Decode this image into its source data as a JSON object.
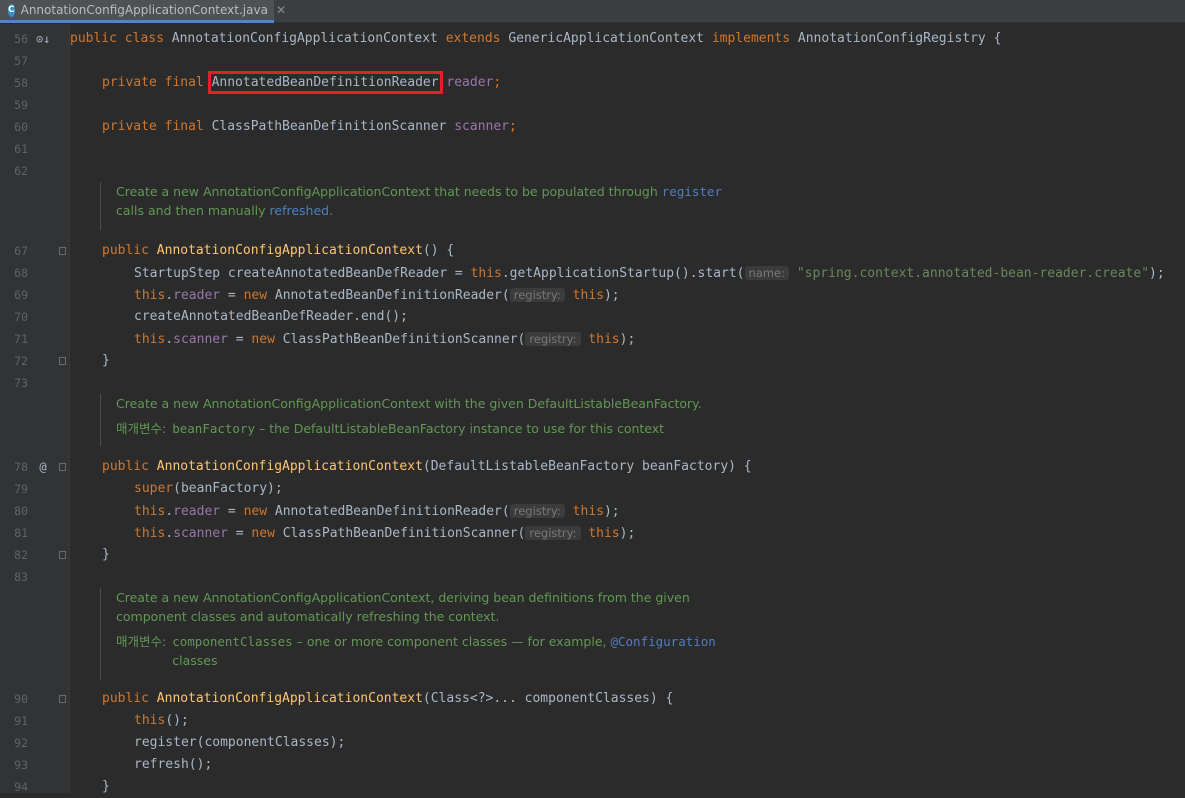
{
  "tab": {
    "icon": "C",
    "filename": "AnnotationConfigApplicationContext.java",
    "close": "✕"
  },
  "lines": [
    {
      "n": "56",
      "mark": "⊙↓",
      "code": [
        [
          "public class ",
          "kw"
        ],
        [
          "AnnotationConfigApplicationContext ",
          ""
        ],
        [
          "extends ",
          "kw"
        ],
        [
          "GenericApplicationContext ",
          ""
        ],
        [
          "implements ",
          "kw"
        ],
        [
          "AnnotationConfigRegistry {",
          ""
        ]
      ]
    },
    {
      "n": "57",
      "code": []
    },
    {
      "n": "58",
      "indent": 1,
      "code": [
        [
          "private final ",
          "kw"
        ],
        [
          "AnnotatedBeanDefinitionReader",
          "box"
        ],
        [
          " ",
          ""
        ],
        [
          "reader",
          "fld"
        ],
        [
          ";",
          "kw"
        ]
      ]
    },
    {
      "n": "59",
      "code": []
    },
    {
      "n": "60",
      "indent": 1,
      "code": [
        [
          "private final ",
          "kw"
        ],
        [
          "ClassPathBeanDefinitionScanner ",
          ""
        ],
        [
          "scanner",
          "fld"
        ],
        [
          ";",
          "kw"
        ]
      ]
    },
    {
      "n": "61",
      "code": []
    },
    {
      "n": "62",
      "code": []
    },
    {
      "n": "67",
      "indent": 1,
      "fold": true,
      "code": [
        [
          "public ",
          "kw"
        ],
        [
          "AnnotationConfigApplicationContext",
          "mth"
        ],
        [
          "() {",
          ""
        ]
      ]
    },
    {
      "n": "68",
      "indent": 2,
      "code": [
        [
          "StartupStep createAnnotatedBeanDefReader = ",
          ""
        ],
        [
          "this",
          "kw"
        ],
        [
          ".getApplicationStartup().start(",
          ""
        ],
        [
          "name:",
          "hint"
        ],
        [
          " ",
          ""
        ],
        [
          "\"spring.context.annotated-bean-reader.create\"",
          "str"
        ],
        [
          ");",
          ""
        ]
      ]
    },
    {
      "n": "69",
      "indent": 2,
      "code": [
        [
          "this",
          "kw"
        ],
        [
          ".",
          ""
        ],
        [
          "reader",
          "fld"
        ],
        [
          " = ",
          ""
        ],
        [
          "new ",
          "kw"
        ],
        [
          "AnnotatedBeanDefinitionReader(",
          ""
        ],
        [
          "registry:",
          "hint"
        ],
        [
          " ",
          ""
        ],
        [
          "this",
          "kw"
        ],
        [
          ");",
          ""
        ]
      ]
    },
    {
      "n": "70",
      "indent": 2,
      "code": [
        [
          "createAnnotatedBeanDefReader.end();",
          ""
        ]
      ]
    },
    {
      "n": "71",
      "indent": 2,
      "code": [
        [
          "this",
          "kw"
        ],
        [
          ".",
          ""
        ],
        [
          "scanner",
          "fld"
        ],
        [
          " = ",
          ""
        ],
        [
          "new ",
          "kw"
        ],
        [
          "ClassPathBeanDefinitionScanner(",
          ""
        ],
        [
          "registry:",
          "hint"
        ],
        [
          " ",
          ""
        ],
        [
          "this",
          "kw"
        ],
        [
          ");",
          ""
        ]
      ]
    },
    {
      "n": "72",
      "indent": 1,
      "fold": true,
      "code": [
        [
          "}",
          ""
        ]
      ]
    },
    {
      "n": "73",
      "code": []
    },
    {
      "n": "78",
      "mark": "@",
      "indent": 1,
      "fold": true,
      "code": [
        [
          "public ",
          "kw"
        ],
        [
          "AnnotationConfigApplicationContext",
          "mth"
        ],
        [
          "(DefaultListableBeanFactory beanFactory) {",
          ""
        ]
      ]
    },
    {
      "n": "79",
      "indent": 2,
      "code": [
        [
          "super",
          "kw"
        ],
        [
          "(beanFactory);",
          ""
        ]
      ]
    },
    {
      "n": "80",
      "indent": 2,
      "code": [
        [
          "this",
          "kw"
        ],
        [
          ".",
          ""
        ],
        [
          "reader",
          "fld"
        ],
        [
          " = ",
          ""
        ],
        [
          "new ",
          "kw"
        ],
        [
          "AnnotatedBeanDefinitionReader(",
          ""
        ],
        [
          "registry:",
          "hint"
        ],
        [
          " ",
          ""
        ],
        [
          "this",
          "kw"
        ],
        [
          ");",
          ""
        ]
      ]
    },
    {
      "n": "81",
      "indent": 2,
      "code": [
        [
          "this",
          "kw"
        ],
        [
          ".",
          ""
        ],
        [
          "scanner",
          "fld"
        ],
        [
          " = ",
          ""
        ],
        [
          "new ",
          "kw"
        ],
        [
          "ClassPathBeanDefinitionScanner(",
          ""
        ],
        [
          "registry:",
          "hint"
        ],
        [
          " ",
          ""
        ],
        [
          "this",
          "kw"
        ],
        [
          ");",
          ""
        ]
      ]
    },
    {
      "n": "82",
      "indent": 1,
      "fold": true,
      "code": [
        [
          "}",
          ""
        ]
      ]
    },
    {
      "n": "83",
      "code": []
    },
    {
      "n": "90",
      "indent": 1,
      "fold": true,
      "code": [
        [
          "public ",
          "kw"
        ],
        [
          "AnnotationConfigApplicationContext",
          "mth"
        ],
        [
          "(Class<?>... componentClasses) {",
          ""
        ]
      ]
    },
    {
      "n": "91",
      "indent": 2,
      "code": [
        [
          "this",
          "kw"
        ],
        [
          "();",
          ""
        ]
      ]
    },
    {
      "n": "92",
      "indent": 2,
      "code": [
        [
          "register(componentClasses);",
          ""
        ]
      ]
    },
    {
      "n": "93",
      "indent": 2,
      "code": [
        [
          "refresh();",
          ""
        ]
      ]
    },
    {
      "n": "94",
      "indent": 1,
      "code": [
        [
          "}",
          ""
        ]
      ]
    }
  ],
  "docs": [
    {
      "rows": [
        [
          [
            "Create a new AnnotationConfigApplicationContext that needs to be populated through ",
            ""
          ],
          [
            "register",
            "link-code"
          ]
        ],
        [
          [
            "calls and then manually ",
            ""
          ],
          [
            "refreshed",
            "link"
          ],
          [
            ".",
            ""
          ]
        ]
      ]
    },
    {
      "rows": [
        [
          [
            "Create a new AnnotationConfigApplicationContext with the given DefaultListableBeanFactory.",
            ""
          ]
        ]
      ],
      "param": {
        "label": "매개변수:",
        "parts": [
          [
            "beanFactory",
            "code"
          ],
          [
            " – the DefaultListableBeanFactory instance to use for this context",
            ""
          ]
        ]
      }
    },
    {
      "rows": [
        [
          [
            "Create a new AnnotationConfigApplicationContext, deriving bean definitions from the given",
            ""
          ]
        ],
        [
          [
            "component classes and automatically refreshing the context.",
            ""
          ]
        ]
      ],
      "param": {
        "label": "매개변수:",
        "parts": [
          [
            "componentClasses",
            "code"
          ],
          [
            " – one or more component classes — for example, ",
            ""
          ],
          [
            "@Configuration",
            "link-code"
          ]
        ],
        "continuation": "classes"
      }
    }
  ],
  "colors": {
    "background": "#2b2b2b",
    "gutter": "#313335",
    "keyword": "#cc7832",
    "field": "#9876aa",
    "string": "#6a8759",
    "method": "#ffc66d",
    "doc": "#629755",
    "highlight_box": "#e0202a"
  },
  "icons": {
    "tab_file": "java-class-icon",
    "override_marker": "implements-marker-icon",
    "annotation_marker": "annotation-marker-icon",
    "fold": "fold-icon"
  }
}
